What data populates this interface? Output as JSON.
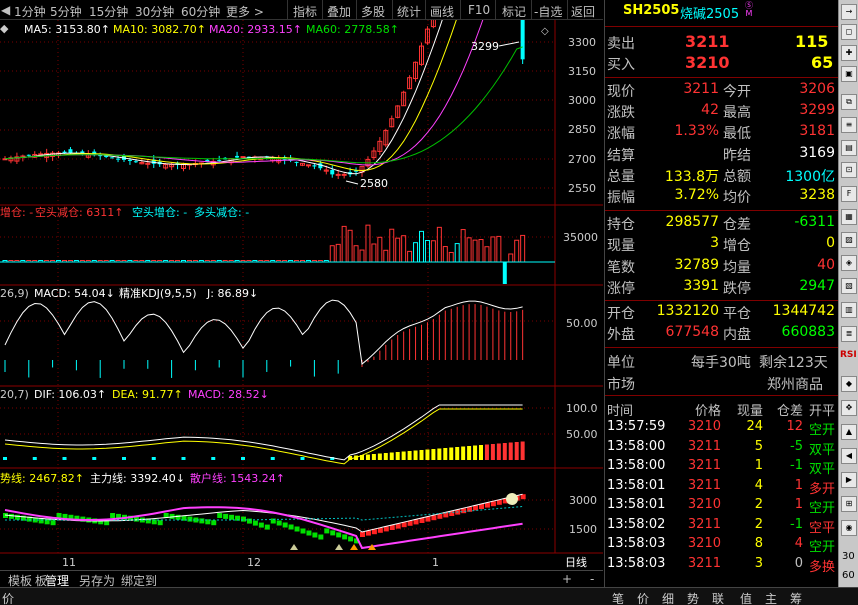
{
  "toolbar": {
    "arrow": "◀",
    "periods": [
      "1分钟",
      "5分钟",
      "15分钟",
      "30分钟",
      "60分钟"
    ],
    "more": "更多 >",
    "tools": [
      "指标",
      "叠加",
      "多股",
      "统计",
      "画线",
      "F10",
      "标记",
      "-自选",
      "返回"
    ]
  },
  "main": {
    "row1": "MA5: 3153.80↑",
    "row2": "MA10: 3082.70↑",
    "row3": "MA20: 2933.15↑",
    "row4": "MA60: 2778.58↑",
    "hi": "3299",
    "lo": "2580",
    "axis": [
      "3300",
      "3150",
      "3000",
      "2850",
      "2700",
      "2550"
    ]
  },
  "oi": {
    "a": "增仓: -",
    "b": "空头减仓: 6311↑",
    "c": "空头增仓: -",
    "d": "多头减仓: -",
    "axis": "35000"
  },
  "kdj": {
    "a": "26,9)",
    "b": "MACD: 54.04↓",
    "c": "精准KDJ(9,5,5)",
    "d": "J: 86.89↓",
    "axis": "50.00"
  },
  "macd": {
    "a": "20,7)",
    "b": "DIF: 106.03↑",
    "c": "DEA: 91.77↑",
    "d": "MACD: 28.52↓",
    "axis": [
      "100.0",
      "50.00"
    ]
  },
  "flow": {
    "a": "势线: 2467.82↑",
    "b": "主力线: 3392.40↓",
    "c": "散户线: 1543.24↑",
    "axis": [
      "3000",
      "1500"
    ]
  },
  "xaxis": {
    "a": "11",
    "b": "12",
    "c": "1",
    "period": "日线"
  },
  "bottom": {
    "items": [
      "模板",
      "板",
      "管理",
      "另存为",
      "绑定到"
    ],
    "plus": "+",
    "minus": "-"
  },
  "status": {
    "left": "价",
    "tabs": [
      "笔",
      "价",
      "细",
      "势",
      "联",
      "值",
      "主",
      "筹"
    ]
  },
  "quote": {
    "code": "SH2505",
    "name": "烧碱2505",
    "sell_label": "卖出",
    "sell_price": "3211",
    "sell_vol": "115",
    "buy_label": "买入",
    "buy_price": "3210",
    "buy_vol": "65",
    "rows": [
      [
        "现价",
        "3211",
        "今开",
        "3206"
      ],
      [
        "涨跌",
        "42",
        "最高",
        "3299"
      ],
      [
        "涨幅",
        "1.33%",
        "最低",
        "3181"
      ],
      [
        "结算",
        "",
        "昨结",
        "3169"
      ],
      [
        "总量",
        "133.8万",
        "总额",
        "1300亿"
      ],
      [
        "振幅",
        "3.72%",
        "均价",
        "3238"
      ],
      [
        "持仓",
        "298577",
        "仓差",
        "-6311"
      ],
      [
        "现量",
        "3",
        "增仓",
        "0"
      ],
      [
        "笔数",
        "32789",
        "均量",
        "40"
      ],
      [
        "涨停",
        "3391",
        "跌停",
        "2947"
      ],
      [
        "开仓",
        "1332120",
        "平仓",
        "1344742"
      ],
      [
        "外盘",
        "677548",
        "内盘",
        "660883"
      ]
    ],
    "unit_label": "单位",
    "unit_value": "每手30吨",
    "remain": "剩余123天",
    "market_label": "市场",
    "market_value": "郑州商品"
  },
  "trades": {
    "headers": [
      "时间",
      "价格",
      "现量",
      "仓差",
      "开平"
    ],
    "rows": [
      [
        "13:57:59",
        "3210",
        "24",
        "12",
        "空开"
      ],
      [
        "13:58:00",
        "3211",
        "5",
        "-5",
        "双平"
      ],
      [
        "13:58:00",
        "3211",
        "1",
        "-1",
        "双平"
      ],
      [
        "13:58:01",
        "3211",
        "4",
        "1",
        "多开"
      ],
      [
        "13:58:01",
        "3210",
        "2",
        "1",
        "空开"
      ],
      [
        "13:58:02",
        "3211",
        "2",
        "-1",
        "空平"
      ],
      [
        "13:58:03",
        "3210",
        "8",
        "4",
        "空开"
      ],
      [
        "13:58:03",
        "3211",
        "3",
        "0",
        "多换"
      ]
    ]
  },
  "sidebar": {
    "top": "RSI",
    "bottom": [
      "30",
      "60"
    ]
  },
  "colors": {
    "up": "#ff3333",
    "down": "#00ffff",
    "ma5": "#ffffff",
    "ma10": "#ffff00",
    "ma20": "#ff40ff",
    "ma60": "#00c000"
  }
}
